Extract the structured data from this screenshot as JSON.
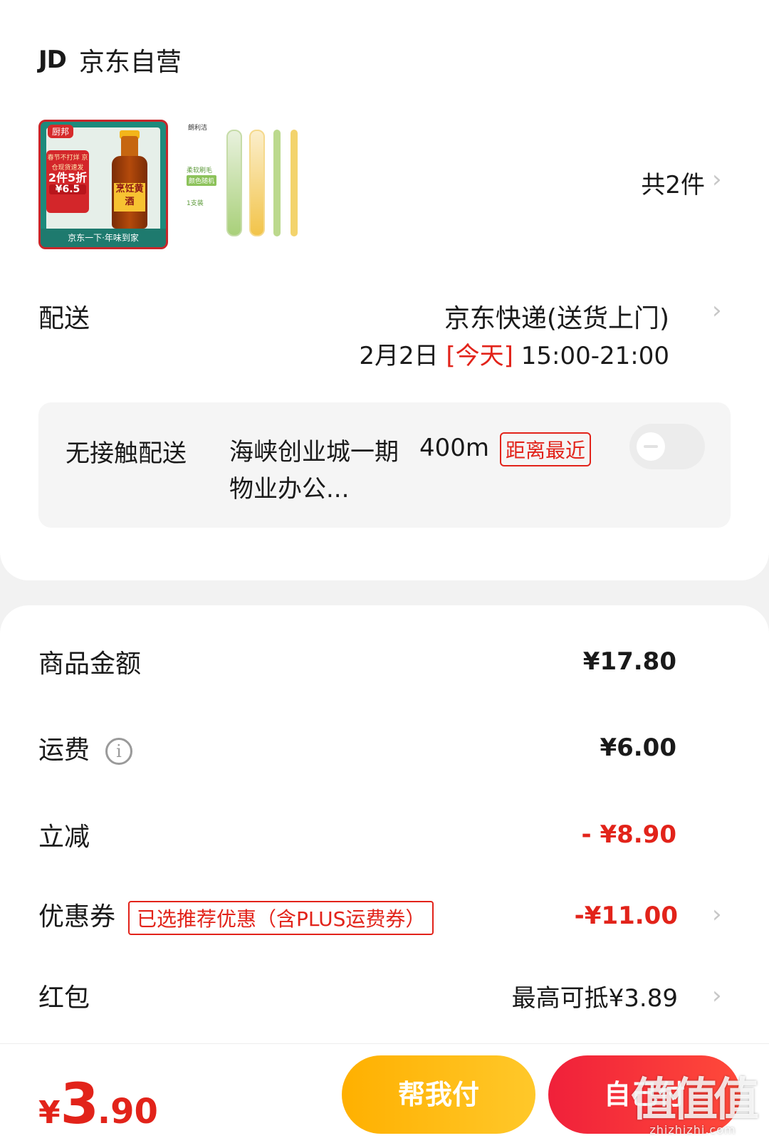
{
  "store": {
    "logo": "JD",
    "name": "京东自营"
  },
  "products": {
    "item1": {
      "badge": "厨邦",
      "promo_line": "春节不打烊 京仓现货速发",
      "promo_big": "2件5折",
      "promo_price": "¥6.5",
      "label": "烹饪黄酒",
      "footer": "京东一下·年味到家"
    },
    "item2": {
      "brand": "朗利洁",
      "soft": "柔软刷毛",
      "color": "颜色随机",
      "count": "1支装"
    },
    "total_count": "共2件"
  },
  "delivery": {
    "label": "配送",
    "method": "京东快递(送货上门)",
    "date": "2月2日",
    "today": "[今天]",
    "time": "15:00-21:00"
  },
  "contactless": {
    "label": "无接触配送",
    "place": "海峡创业城一期物业办公...",
    "distance": "400m",
    "tag": "距离最近",
    "enabled": false
  },
  "fees": {
    "goods": {
      "label": "商品金额",
      "value": "¥17.80"
    },
    "shipping": {
      "label": "运费",
      "value": "¥6.00"
    },
    "discount": {
      "label": "立减",
      "value": "- ¥8.90"
    },
    "coupon": {
      "label": "优惠券",
      "tag": "已选推荐优惠（含PLUS运费券）",
      "value": "-¥11.00"
    },
    "redpacket": {
      "label": "红包",
      "value": "最高可抵¥3.89"
    }
  },
  "bottom": {
    "currency": "¥",
    "total_int": "3",
    "total_dec": ".90",
    "help_pay": "帮我付",
    "self_pay": "自己付"
  },
  "watermark": {
    "icon": "值值值",
    "text": "zhizhizhi.com"
  },
  "colors": {
    "accent_red": "#e2231a",
    "help_orange": "#ffb000",
    "self_red": "#f0203a"
  }
}
